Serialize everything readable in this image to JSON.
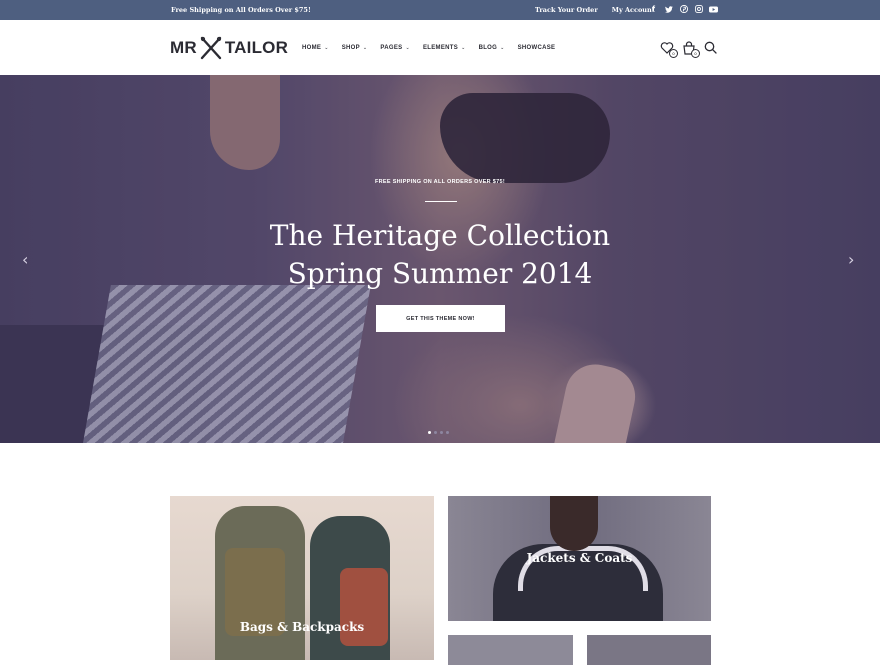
{
  "topbar": {
    "promo": "Free Shipping on All Orders Over $75!",
    "links": [
      "Track Your Order",
      "My Account"
    ],
    "social": [
      "facebook-icon",
      "twitter-icon",
      "pinterest-icon",
      "instagram-icon",
      "youtube-icon"
    ]
  },
  "header": {
    "logo_left": "MR",
    "logo_right": "TAILOR",
    "nav": [
      {
        "label": "HOME",
        "dropdown": true
      },
      {
        "label": "SHOP",
        "dropdown": true
      },
      {
        "label": "PAGES",
        "dropdown": true
      },
      {
        "label": "ELEMENTS",
        "dropdown": true
      },
      {
        "label": "BLOG",
        "dropdown": true
      },
      {
        "label": "SHOWCASE",
        "dropdown": false
      }
    ],
    "wishlist_count": "0",
    "cart_count": "0"
  },
  "hero": {
    "tagline": "FREE SHIPPING ON ALL ORDERS OVER $75!",
    "title_line1": "The Heritage Collection",
    "title_line2": "Spring Summer 2014",
    "cta": "GET THIS THEME NOW!",
    "slide_count": 4,
    "active_slide": 1
  },
  "categories": [
    {
      "label": "Bags & Backpacks"
    },
    {
      "label": "Jackets & Coats"
    },
    {
      "label": ""
    },
    {
      "label": ""
    }
  ],
  "colors": {
    "topbar_bg": "#4e5f80",
    "text_dark": "#2b2b33"
  }
}
